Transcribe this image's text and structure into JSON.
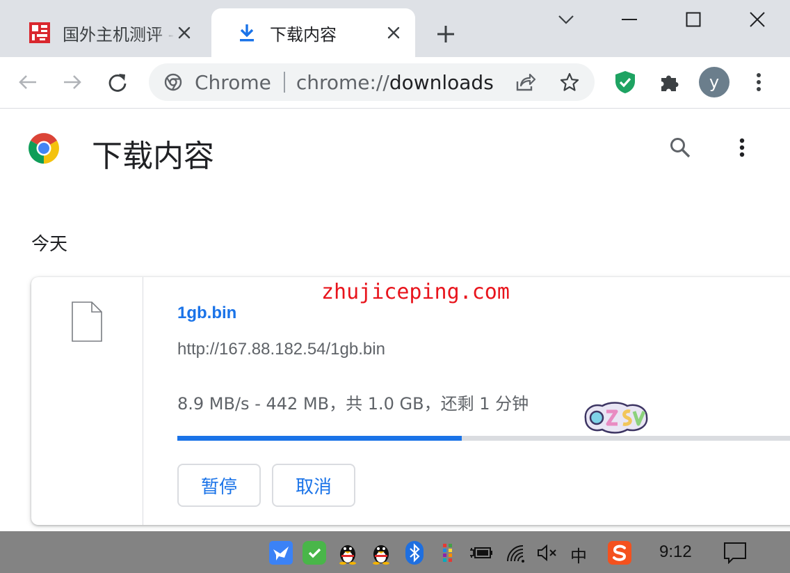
{
  "tabs": [
    {
      "title": "国外主机测评 - ",
      "favicon": "site-logo-icon",
      "active": false
    },
    {
      "title": "下载内容",
      "favicon": "download-icon",
      "active": true
    }
  ],
  "toolbar": {
    "omnibox": {
      "chrome_label": "Chrome",
      "url_scheme": "chrome://",
      "url_host": "downloads"
    },
    "profile_initial": "y"
  },
  "page": {
    "title": "下载内容",
    "section_label": "今天"
  },
  "download": {
    "file_name": "1gb.bin",
    "url": "http://167.88.182.54/1gb.bin",
    "status": "8.9 MB/s - 442 MB，共 1.0 GB，还剩 1 分钟",
    "progress_percent": 44,
    "pause_label": "暂停",
    "cancel_label": "取消"
  },
  "watermark": "zhujiceping.com",
  "taskbar": {
    "ime_label": "中",
    "clock": "9:12"
  },
  "colors": {
    "accent": "#1a73e8",
    "tabstrip": "#dee1e6",
    "taskbar": "#838383",
    "watermark": "#e8141c",
    "shield": "#1ea362"
  }
}
